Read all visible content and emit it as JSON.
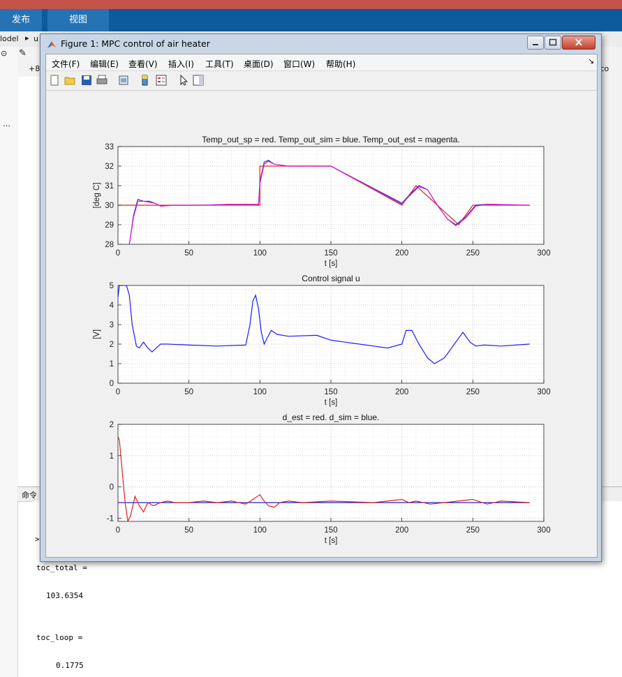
{
  "ribbon": {
    "tab1": "发布",
    "tab2": "视图"
  },
  "left_panel": {
    "model_label": "lodel",
    "u_label": "u",
    "plus_label": "+8",
    "right_clip": "n_co",
    "dots": "…",
    "cmd_label": "命令"
  },
  "figure": {
    "title": "Figure 1: MPC control of air heater",
    "menu": [
      "文件(F)",
      "编辑(E)",
      "查看(V)",
      "插入(I)",
      "工具(T)",
      "桌面(D)",
      "窗口(W)",
      "帮助(H)"
    ],
    "toolbar_icons": [
      "new-file-icon",
      "open-folder-icon",
      "save-icon",
      "print-icon",
      "print-preview-icon",
      "colorbar-icon",
      "legend-icon",
      "pointer-icon",
      "property-icon"
    ]
  },
  "command_window": {
    "lines": [
      "toc_total =",
      "103.6354",
      "toc_loop =",
      "0.1775"
    ],
    "prompt": ">"
  },
  "chart_data": [
    {
      "type": "line",
      "title": "Temp_out_sp = red. Temp_out_sim = blue. Temp_out_est = magenta.",
      "xlabel": "t [s]",
      "ylabel": "[deg C]",
      "xlim": [
        0,
        300
      ],
      "ylim": [
        28,
        33
      ],
      "xticks": [
        0,
        50,
        100,
        150,
        200,
        250,
        300
      ],
      "yticks": [
        28,
        29,
        30,
        31,
        32,
        33
      ],
      "grid": true,
      "series": [
        {
          "color": "#e02020",
          "x": [
            0,
            100,
            100,
            150,
            200,
            210,
            225,
            240,
            250,
            290
          ],
          "y": [
            30,
            30,
            32,
            32,
            30,
            31,
            30,
            29,
            30,
            30
          ]
        },
        {
          "color": "#2030c0",
          "x": [
            8,
            11,
            14,
            18,
            22,
            26,
            30,
            40,
            60,
            80,
            99,
            100,
            103,
            106,
            110,
            120,
            150,
            200,
            205,
            212,
            218,
            225,
            232,
            238,
            245,
            252,
            260,
            290
          ],
          "y": [
            28,
            29.5,
            30.3,
            30.2,
            30.2,
            30.1,
            29.95,
            30,
            30,
            30.05,
            30.05,
            31.2,
            32.2,
            32.3,
            32.1,
            32,
            32,
            30.1,
            30.5,
            31,
            30.8,
            30,
            29.3,
            29,
            29.4,
            30,
            30.05,
            30
          ]
        },
        {
          "color": "#e020d0",
          "x": [
            8,
            11,
            14,
            18,
            22,
            26,
            30,
            40,
            60,
            80,
            99,
            100,
            103,
            106,
            110,
            120,
            150,
            200,
            205,
            212,
            218,
            225,
            232,
            238,
            245,
            252,
            260,
            290
          ],
          "y": [
            28,
            29.4,
            30.2,
            30.2,
            30.15,
            30.1,
            29.95,
            30,
            30,
            30.05,
            30.05,
            31.1,
            32.1,
            32.25,
            32.1,
            32,
            32,
            30.05,
            30.45,
            30.95,
            30.8,
            30,
            29.3,
            28.95,
            29.35,
            29.95,
            30.05,
            30
          ]
        }
      ]
    },
    {
      "type": "line",
      "title": "Control signal u",
      "xlabel": "t [s]",
      "ylabel": "[V]",
      "xlim": [
        0,
        300
      ],
      "ylim": [
        0,
        5
      ],
      "xticks": [
        0,
        50,
        100,
        150,
        200,
        250,
        300
      ],
      "yticks": [
        0,
        1,
        2,
        3,
        4,
        5
      ],
      "grid": true,
      "series": [
        {
          "color": "#1a1aff",
          "x": [
            0,
            1,
            2,
            6,
            8,
            10,
            13,
            15,
            18,
            21,
            24,
            27,
            30,
            35,
            50,
            70,
            90,
            93,
            95,
            97,
            99,
            101,
            103,
            105,
            108,
            112,
            120,
            140,
            150,
            160,
            180,
            190,
            200,
            203,
            207,
            212,
            218,
            223,
            230,
            238,
            243,
            248,
            252,
            258,
            270,
            290
          ],
          "y": [
            4.4,
            5,
            5,
            5,
            4.5,
            3,
            1.9,
            1.8,
            2.1,
            1.8,
            1.6,
            1.8,
            2,
            2,
            1.95,
            1.9,
            1.95,
            3,
            4.2,
            4.5,
            3.8,
            2.6,
            2,
            2.3,
            2.7,
            2.5,
            2.4,
            2.45,
            2.2,
            2.1,
            1.9,
            1.8,
            2,
            2.7,
            2.7,
            2,
            1.3,
            1,
            1.3,
            2.1,
            2.6,
            2.1,
            1.9,
            1.95,
            1.9,
            2
          ]
        }
      ]
    },
    {
      "type": "line",
      "title": "d_est = red. d_sim = blue.",
      "xlabel": "t [s]",
      "ylabel": "",
      "xlim": [
        0,
        300
      ],
      "ylim": [
        -1.1,
        2
      ],
      "xticks": [
        0,
        50,
        100,
        150,
        200,
        250,
        300
      ],
      "yticks": [
        -1,
        0,
        1,
        2
      ],
      "grid": true,
      "series": [
        {
          "color": "#2020d0",
          "x": [
            0,
            290
          ],
          "y": [
            -0.5,
            -0.5
          ]
        },
        {
          "color": "#e02020",
          "x": [
            0,
            1,
            3,
            5,
            7,
            9,
            12,
            15,
            18,
            21,
            25,
            30,
            35,
            40,
            50,
            60,
            70,
            80,
            90,
            95,
            100,
            103,
            106,
            110,
            114,
            120,
            130,
            150,
            180,
            200,
            205,
            210,
            220,
            250,
            260,
            270,
            290
          ],
          "y": [
            1.6,
            1.5,
            0.5,
            -0.5,
            -1.1,
            -0.9,
            -0.3,
            -0.6,
            -0.8,
            -0.5,
            -0.6,
            -0.5,
            -0.45,
            -0.5,
            -0.5,
            -0.45,
            -0.5,
            -0.45,
            -0.55,
            -0.4,
            -0.25,
            -0.45,
            -0.6,
            -0.65,
            -0.5,
            -0.45,
            -0.5,
            -0.45,
            -0.5,
            -0.4,
            -0.5,
            -0.45,
            -0.55,
            -0.4,
            -0.55,
            -0.45,
            -0.5
          ]
        }
      ]
    }
  ]
}
